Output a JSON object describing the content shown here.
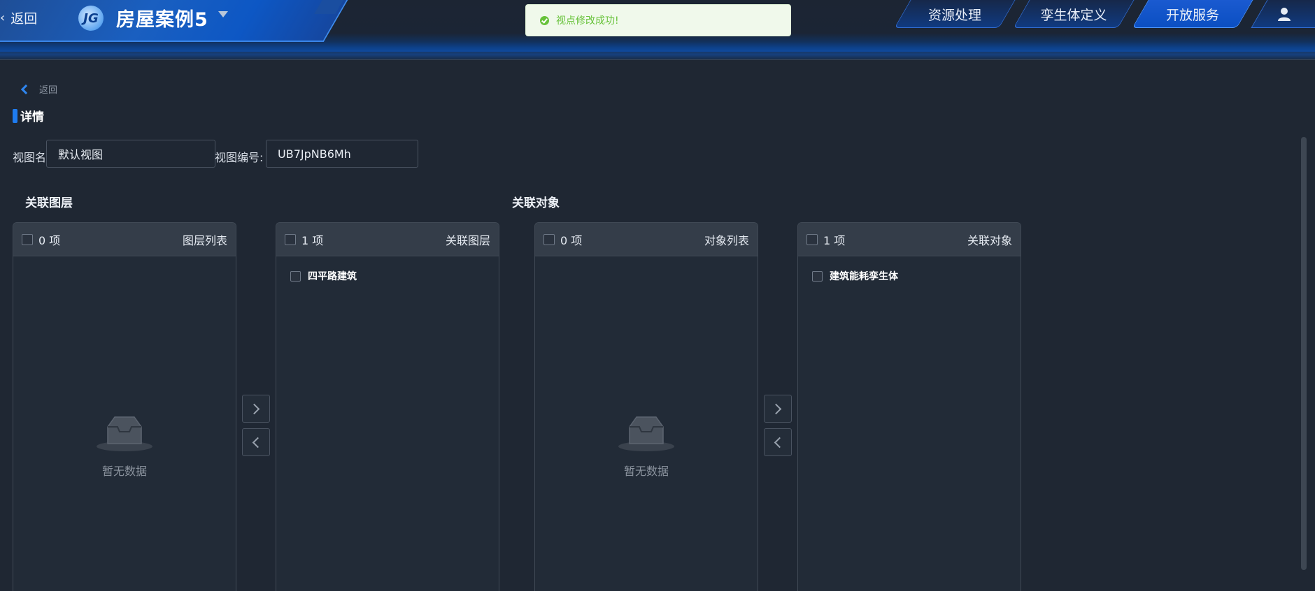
{
  "header": {
    "back_label": "返回",
    "app_title": "房屋案例5",
    "logo_text": "JG",
    "nav_tabs": [
      {
        "label": "资源处理"
      },
      {
        "label": "孪生体定义"
      },
      {
        "label": "开放服务"
      }
    ],
    "user_icon": "user-icon"
  },
  "toast": {
    "message": "视点修改成功!",
    "icon": "success-check-icon",
    "color": "#67c23a"
  },
  "breadcrumb": {
    "back_label": "返回"
  },
  "section": {
    "title": "详情"
  },
  "form": {
    "view_name_label": "视图名",
    "view_name_value": "默认视图",
    "view_code_label": "视图编号:",
    "view_code_value": "UB7JpNB6Mh"
  },
  "layers": {
    "group_title": "关联图层",
    "source": {
      "count": "0 项",
      "title": "图层列表",
      "empty_text": "暂无数据",
      "items": []
    },
    "target": {
      "count": "1 项",
      "title": "关联图层",
      "items": [
        {
          "label": "四平路建筑"
        }
      ]
    }
  },
  "objects": {
    "group_title": "关联对象",
    "source": {
      "count": "0 项",
      "title": "对象列表",
      "empty_text": "暂无数据",
      "items": []
    },
    "target": {
      "count": "1 项",
      "title": "关联对象",
      "items": [
        {
          "label": "建筑能耗孪生体"
        }
      ]
    }
  },
  "colors": {
    "accent": "#1e7cf0",
    "background": "#1f2733",
    "panel_header": "#343d49",
    "success": "#67c23a"
  }
}
